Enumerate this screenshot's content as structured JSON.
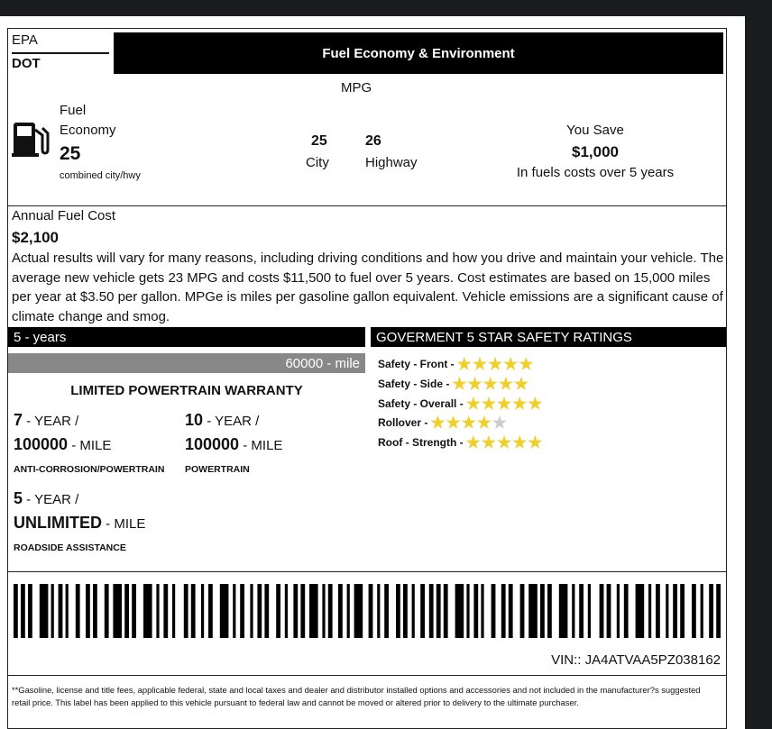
{
  "header": {
    "epa": "EPA",
    "dot": "DOT",
    "title": "Fuel Economy & Environment",
    "mpg_label": "MPG"
  },
  "fuel_economy": {
    "word1": "Fuel",
    "word2": "Economy",
    "combined": "25",
    "combined_sub": "combined city/hwy",
    "city_value": "25",
    "city_label": "City",
    "highway_value": "26",
    "highway_label": "Highway",
    "icon": "fuel-pump-icon"
  },
  "savings": {
    "title": "You Save",
    "amount": "$1,000",
    "subtitle": "In fuels costs over 5 years"
  },
  "annual": {
    "title": "Annual Fuel Cost",
    "amount": "$2,100",
    "text": "Actual results will vary for many reasons, including driving conditions and how you drive and maintain your vehicle. The average new vehicle gets 23 MPG and costs $11,500 to fuel over 5 years. Cost estimates are based on 15,000 miles per year at $3.50 per gallon. MPGe is miles per gasoline gallon equivalent. Vehicle emissions are a significant cause of climate change and smog."
  },
  "warranty": {
    "years_bar": "5 - years",
    "mile_bar": "60000 - mile",
    "title": "LIMITED POWERTRAIN WARRANTY",
    "items": [
      {
        "years_num": "7",
        "years_suffix": " - YEAR /",
        "miles_num": "100000",
        "miles_suffix": " - MILE",
        "note": "ANTI-CORROSION/POWERTRAIN"
      },
      {
        "years_num": "10",
        "years_suffix": " - YEAR /",
        "miles_num": "100000",
        "miles_suffix": " - MILE",
        "note": "POWERTRAIN"
      },
      {
        "years_num": "5",
        "years_suffix": " - YEAR /",
        "miles_num": "UNLIMITED",
        "miles_suffix": " - MILE",
        "note": "ROADSIDE ASSISTANCE"
      }
    ]
  },
  "safety": {
    "title": "GOVERMENT 5 STAR SAFETY RATINGS",
    "star_color": "#f0cf2a",
    "empty_star_color": "#cccccc",
    "ratings": [
      {
        "label": "Safety - Front - ",
        "stars": 5
      },
      {
        "label": "Safety - Side - ",
        "stars": 5
      },
      {
        "label": "Safety - Overall - ",
        "stars": 5
      },
      {
        "label": "Rollover - ",
        "stars": 4
      },
      {
        "label": "Roof - Strength - ",
        "stars": 5
      }
    ]
  },
  "vin": "VIN:: JA4ATVAA5PZ038162",
  "disclaimer": "**Gasoline, license and title fees, applicable federal, state and local taxes and dealer and distributor installed options and accessories and not included in the manufacturer?s suggested retail price. This label has been applied to this vehicle pursuant to federal law and cannot be moved or altered prior to delivery to the ultimate purchaser."
}
